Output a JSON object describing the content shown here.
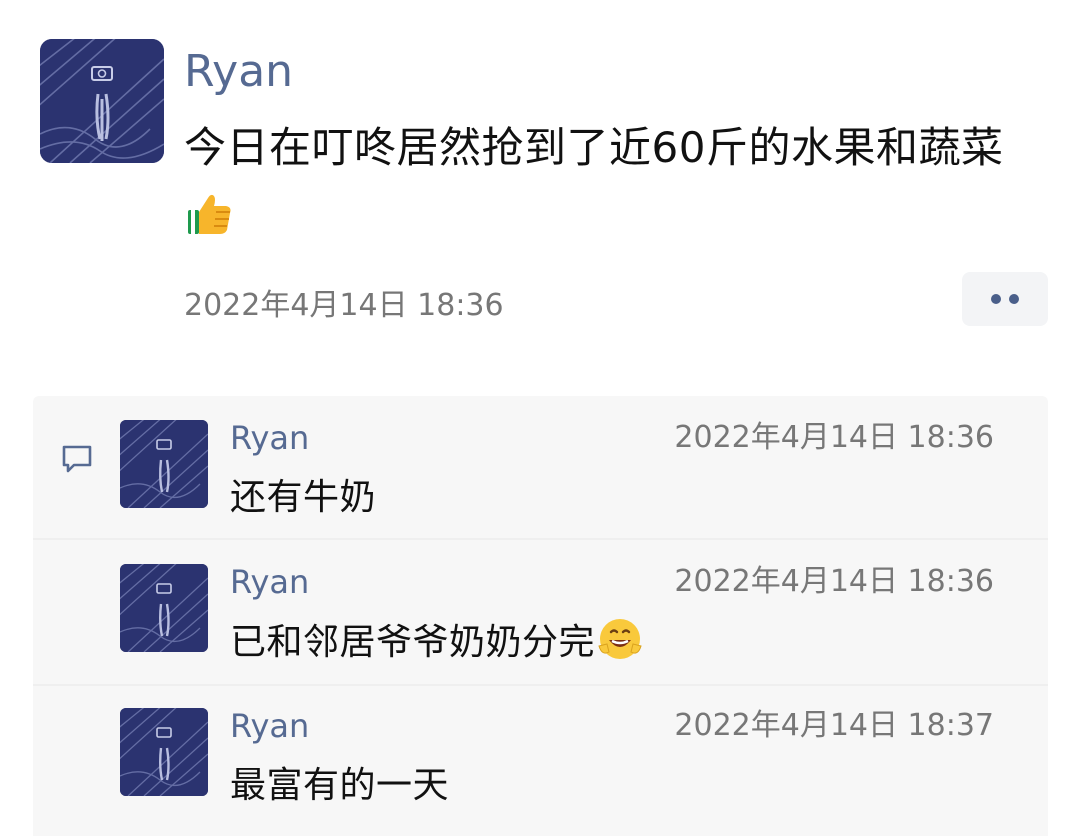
{
  "post": {
    "author": "Ryan",
    "text": "今日在叮咚居然抢到了近60斤的水果和蔬菜",
    "text_emoji": "thumbs-up-icon",
    "timestamp": "2022年4月14日 18:36",
    "more_icon": "more-dots-icon"
  },
  "comments": [
    {
      "author": "Ryan",
      "timestamp": "2022年4月14日 18:36",
      "text": "还有牛奶"
    },
    {
      "author": "Ryan",
      "timestamp": "2022年4月14日 18:36",
      "text": "已和邻居爷爷奶奶分完",
      "text_emoji": "grinning-face-icon"
    },
    {
      "author": "Ryan",
      "timestamp": "2022年4月14日 18:37",
      "text": "最富有的一天"
    }
  ],
  "comments_icon": "comment-icon",
  "colors": {
    "author_name": "#566a92",
    "timestamp": "#777777",
    "panel_bg": "#f7f7f7",
    "avatar_bg": "#2b3370"
  }
}
